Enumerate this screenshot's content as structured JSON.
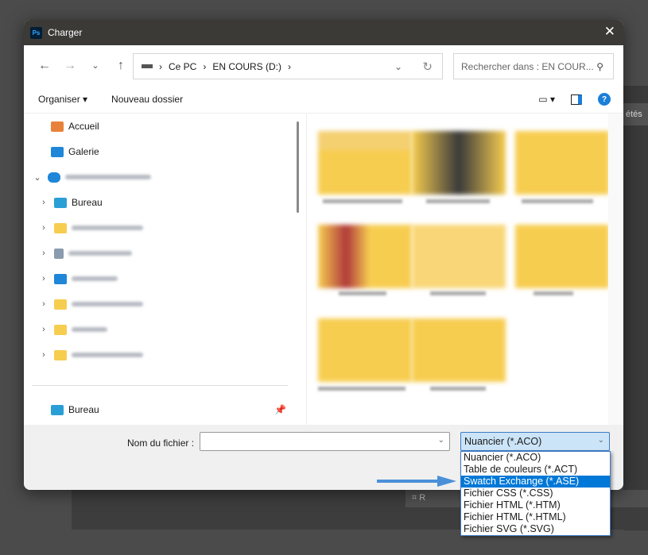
{
  "background": {
    "panel_label": "étés",
    "strip_label": "R"
  },
  "dialog": {
    "title": "Charger",
    "app_icon": "Ps"
  },
  "address": {
    "path": [
      "Ce PC",
      "EN COURS (D:)"
    ],
    "search_placeholder": "Rechercher dans : EN COUR..."
  },
  "toolbar": {
    "organise": "Organiser",
    "new_folder": "Nouveau dossier",
    "help": "?"
  },
  "nav": {
    "items": [
      {
        "label": "Accueil"
      },
      {
        "label": "Galerie"
      },
      {
        "label": "Bureau"
      }
    ],
    "pinned": "Bureau"
  },
  "bottom": {
    "filename_label": "Nom du fichier :",
    "filename_value": "",
    "filter_selected": "Nuancier (*.ACO)"
  },
  "filter_options": [
    "Nuancier (*.ACO)",
    "Table de couleurs (*.ACT)",
    "Swatch Exchange (*.ASE)",
    "Fichier CSS (*.CSS)",
    "Fichier HTML (*.HTM)",
    "Fichier HTML (*.HTML)",
    "Fichier SVG (*.SVG)"
  ],
  "highlighted_option": "Swatch Exchange (*.ASE)",
  "colors": {
    "accent": "#0078d7",
    "arrow": "#4a90d9",
    "folder": "#f7cd50"
  }
}
